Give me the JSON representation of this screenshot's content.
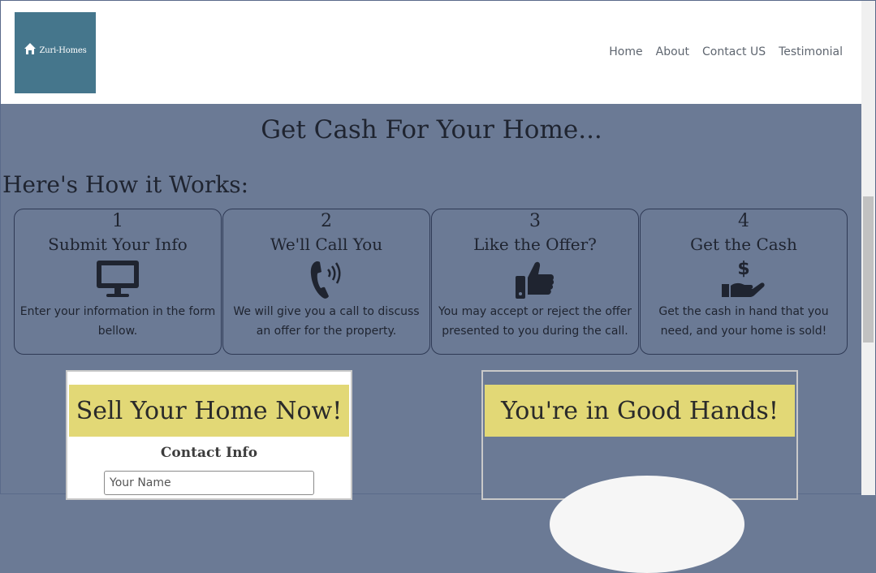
{
  "header": {
    "logo_text": "Zuri-Homes",
    "nav": [
      "Home",
      "About",
      "Contact US",
      "Testimonial"
    ]
  },
  "hero": {
    "title": "Get Cash For Your Home..."
  },
  "how": {
    "title": "Here's How it Works:",
    "steps": [
      {
        "num": "1",
        "title": "Submit Your Info",
        "icon": "monitor-icon",
        "desc": "Enter your information in the form bellow."
      },
      {
        "num": "2",
        "title": "We'll Call You",
        "icon": "phone-icon",
        "desc": "We will give you a call to discuss an offer for the property."
      },
      {
        "num": "3",
        "title": "Like the Offer?",
        "icon": "thumbs-up-icon",
        "desc": "You may accept or reject the offer presented to you during the call."
      },
      {
        "num": "4",
        "title": "Get the Cash",
        "icon": "hand-dollar-icon",
        "desc": "Get the cash in hand that you need, and your home is sold!"
      }
    ]
  },
  "sell_card": {
    "banner": "Sell Your Home Now!",
    "heading": "Contact Info",
    "name_placeholder": "Your Name"
  },
  "hands_card": {
    "banner": "You're in Good Hands!"
  },
  "colors": {
    "background": "#6b7a95",
    "logo_bg": "#45768c",
    "banner": "#e2d876"
  }
}
